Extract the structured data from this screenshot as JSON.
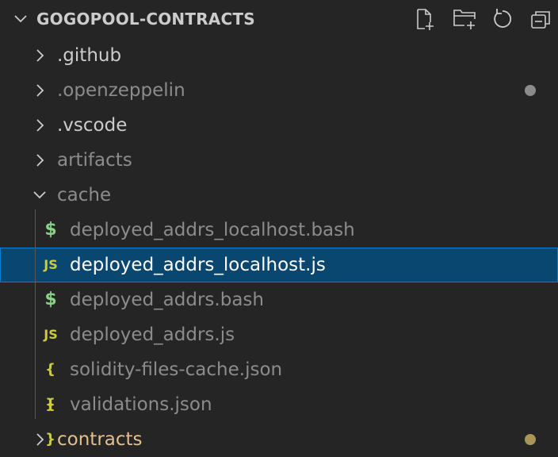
{
  "explorer": {
    "title": "GOGOPOOL-CONTRACTS",
    "actions": [
      {
        "name": "new-file",
        "icon": "new-file-icon"
      },
      {
        "name": "new-folder",
        "icon": "new-folder-icon"
      },
      {
        "name": "refresh",
        "icon": "refresh-icon"
      },
      {
        "name": "collapse-all",
        "icon": "collapse-all-icon"
      }
    ]
  },
  "tree": [
    {
      "label": ".github",
      "type": "folder",
      "expanded": false,
      "style": "normal"
    },
    {
      "label": ".openzeppelin",
      "type": "folder",
      "expanded": false,
      "style": "dim",
      "dot": "#8c8c8c"
    },
    {
      "label": ".vscode",
      "type": "folder",
      "expanded": false,
      "style": "normal"
    },
    {
      "label": "artifacts",
      "type": "folder",
      "expanded": false,
      "style": "dim"
    },
    {
      "label": "cache",
      "type": "folder",
      "expanded": true,
      "style": "dim"
    },
    {
      "label": "deployed_addrs_localhost.bash",
      "type": "file",
      "icon": "$",
      "icon_name": "shell-icon",
      "style": "dim"
    },
    {
      "label": "deployed_addrs_localhost.js",
      "type": "file",
      "icon": "JS",
      "icon_name": "js-icon",
      "style": "selected"
    },
    {
      "label": "deployed_addrs.bash",
      "type": "file",
      "icon": "$",
      "icon_name": "shell-icon",
      "style": "dim"
    },
    {
      "label": "deployed_addrs.js",
      "type": "file",
      "icon": "JS",
      "icon_name": "js-icon",
      "style": "dim"
    },
    {
      "label": "solidity-files-cache.json",
      "type": "file",
      "icon": "{ }",
      "icon_name": "json-icon",
      "style": "dim"
    },
    {
      "label": "validations.json",
      "type": "file",
      "icon": "{ }",
      "icon_name": "json-icon",
      "style": "dim"
    },
    {
      "label": "contracts",
      "type": "folder",
      "expanded": false,
      "style": "modified",
      "dot": "#a89558"
    }
  ],
  "colors": {
    "background": "#252526",
    "selection": "#094771",
    "selection_border": "#007fd4",
    "modified": "#e2c08d"
  }
}
